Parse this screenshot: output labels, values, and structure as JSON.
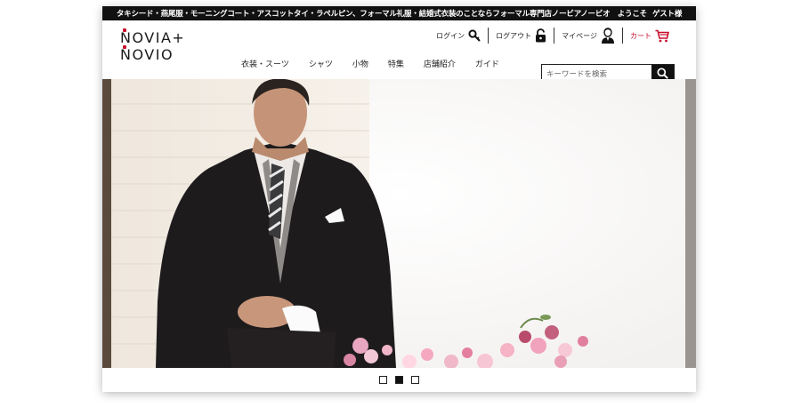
{
  "topbar": {
    "message": "タキシード・燕尾服・モーニングコート・アスコットタイ・ラペルピン、フォーマル礼服・結婚式衣装のことならフォーマル専門店ノービアノービオ　ようこそ",
    "guest": "ゲスト様"
  },
  "logo": {
    "line1": "NOVIA+",
    "line2": "NOVIO"
  },
  "account": {
    "login": "ログイン",
    "logout": "ログアウト",
    "mypage": "マイページ",
    "cart": "カート",
    "icons": [
      "key-icon",
      "padlock-icon",
      "user-icon",
      "cart-icon"
    ],
    "cart_color": "#c8102e"
  },
  "nav": {
    "items": [
      "衣装・スーツ",
      "シャツ",
      "小物",
      "特集",
      "店舗紹介",
      "ガイド"
    ]
  },
  "search": {
    "placeholder": "キーワードを検索",
    "icon": "search-icon"
  },
  "slider": {
    "count": 3,
    "active": 2
  }
}
